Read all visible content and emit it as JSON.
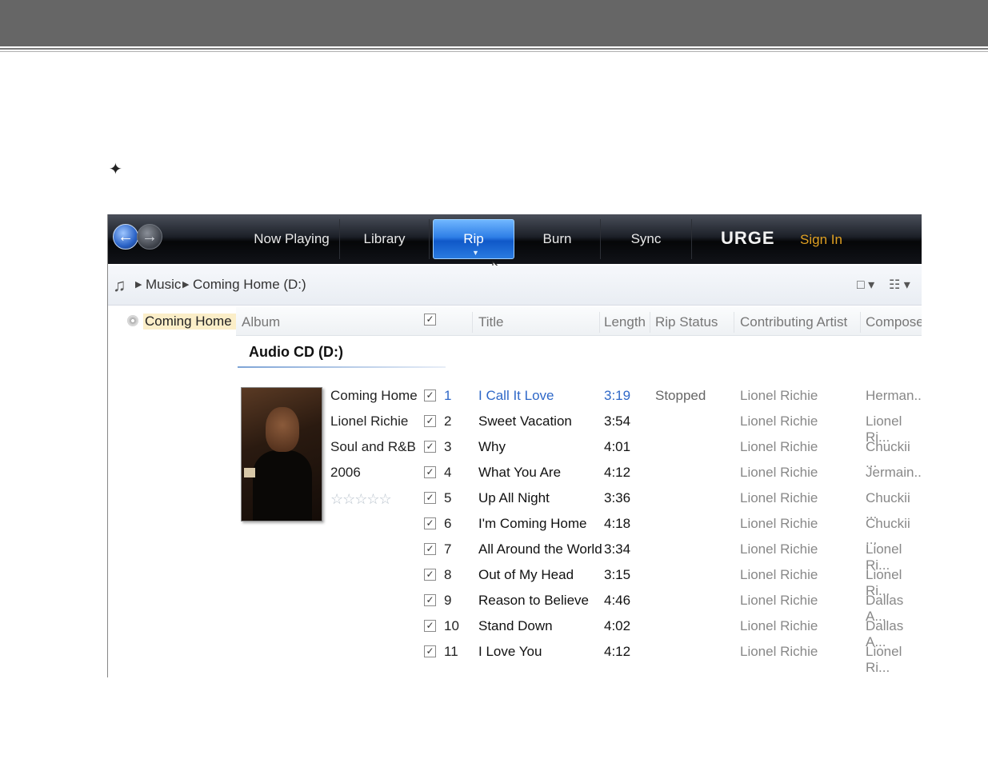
{
  "slide": {
    "bullet": "✦"
  },
  "toolbar": {
    "tabs": [
      "Now Playing",
      "Library",
      "Rip",
      "Burn",
      "Sync"
    ],
    "brand": "URGE",
    "sign_in": "Sign In",
    "active_tab": "Rip",
    "accent": "#2e7ee6"
  },
  "breadcrumb": {
    "root": "Music",
    "current": "Coming Home (D:)"
  },
  "nav_pane": {
    "selected": "Coming Home (D:)"
  },
  "columns": [
    "Album",
    "Title",
    "Length",
    "Rip Status",
    "Contributing Artist",
    "Composer"
  ],
  "group": {
    "title": "Audio CD (D:)"
  },
  "album": {
    "name": "Coming Home",
    "artist": "Lionel Richie",
    "genre": "Soul and R&B",
    "year": "2006",
    "rating": 0
  },
  "tracks": [
    {
      "num": "1",
      "title": "I Call It Love",
      "length": "3:19",
      "status": "Stopped",
      "artist": "Lionel Richie",
      "composer": "Herman..."
    },
    {
      "num": "2",
      "title": "Sweet Vacation",
      "length": "3:54",
      "status": "",
      "artist": "Lionel Richie",
      "composer": "Lionel Ri..."
    },
    {
      "num": "3",
      "title": "Why",
      "length": "4:01",
      "status": "",
      "artist": "Lionel Richie",
      "composer": "Chuckii ..."
    },
    {
      "num": "4",
      "title": "What You Are",
      "length": "4:12",
      "status": "",
      "artist": "Lionel Richie",
      "composer": "Jermain..."
    },
    {
      "num": "5",
      "title": "Up All Night",
      "length": "3:36",
      "status": "",
      "artist": "Lionel Richie",
      "composer": "Chuckii ..."
    },
    {
      "num": "6",
      "title": "I'm Coming Home",
      "length": "4:18",
      "status": "",
      "artist": "Lionel Richie",
      "composer": "Chuckii ..."
    },
    {
      "num": "7",
      "title": "All Around the World",
      "length": "3:34",
      "status": "",
      "artist": "Lionel Richie",
      "composer": "Lionel Ri..."
    },
    {
      "num": "8",
      "title": "Out of My Head",
      "length": "3:15",
      "status": "",
      "artist": "Lionel Richie",
      "composer": "Lionel Ri..."
    },
    {
      "num": "9",
      "title": "Reason to Believe",
      "length": "4:46",
      "status": "",
      "artist": "Lionel Richie",
      "composer": "Dallas A..."
    },
    {
      "num": "10",
      "title": "Stand Down",
      "length": "4:02",
      "status": "",
      "artist": "Lionel Richie",
      "composer": "Dallas A..."
    },
    {
      "num": "11",
      "title": "I Love You",
      "length": "4:12",
      "status": "",
      "artist": "Lionel Richie",
      "composer": "Lionel Ri..."
    }
  ]
}
